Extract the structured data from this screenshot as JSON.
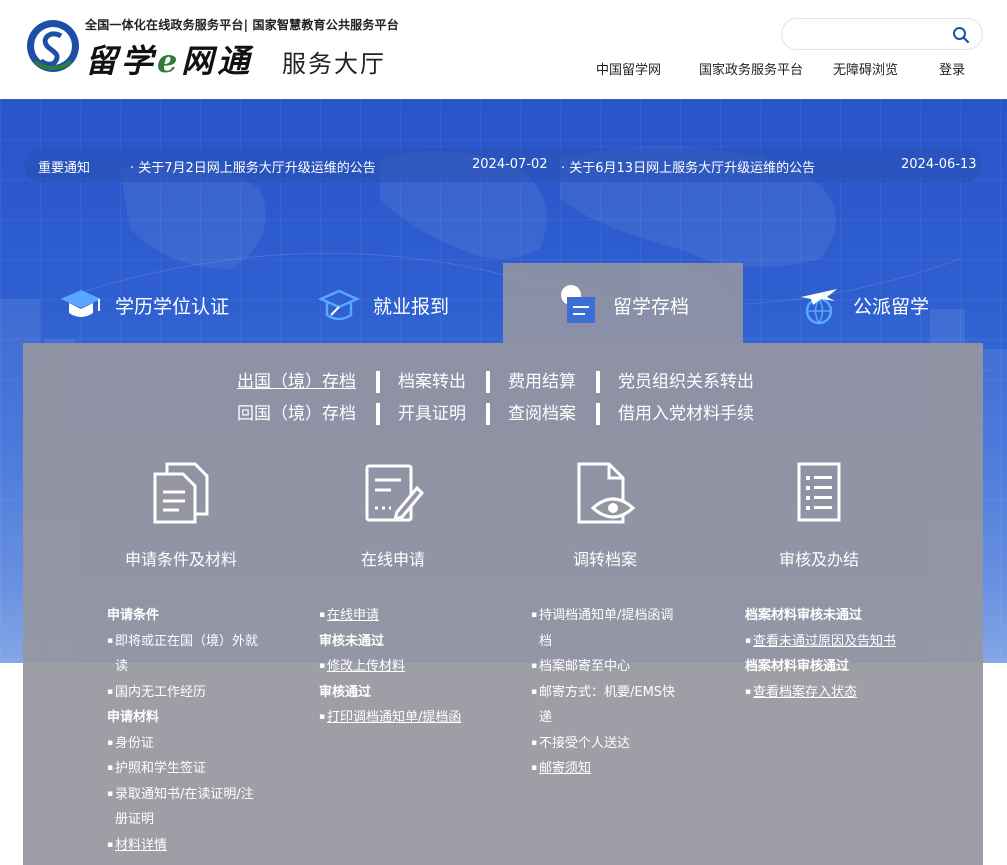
{
  "header": {
    "tagline": "全国一体化在线政务服务平台| 国家智慧教育公共服务平台",
    "title_part1": "留学",
    "title_e": "e",
    "title_part2": "网通",
    "subtitle": "服务大厅",
    "search": {
      "placeholder": "",
      "value": ""
    },
    "nav": [
      "中国留学网",
      "国家政务服务平台",
      "无障碍浏览",
      "登录"
    ]
  },
  "notices": {
    "label": "重要通知",
    "items": [
      {
        "text": "关于7月2日网上服务大厅升级运维的公告",
        "date": "2024-07-02"
      },
      {
        "text": "关于6月13日网上服务大厅升级运维的公告",
        "date": "2024-06-13"
      }
    ]
  },
  "tabs": [
    {
      "label": "学历学位认证",
      "icon": "graduation-cap-icon"
    },
    {
      "label": "就业报到",
      "icon": "scholar-cap-icon"
    },
    {
      "label": "留学存档",
      "icon": "archive-icon",
      "active": true
    },
    {
      "label": "公派留学",
      "icon": "plane-globe-icon"
    }
  ],
  "services": {
    "row1": [
      "出国（境）存档",
      "档案转出",
      "费用结算",
      "党员组织关系转出"
    ],
    "row2": [
      "回国（境）存档",
      "开具证明",
      "查阅档案",
      "借用入党材料手续"
    ]
  },
  "steps": [
    {
      "label": "申请条件及材料",
      "icon": "documents-icon"
    },
    {
      "label": "在线申请",
      "icon": "form-edit-icon"
    },
    {
      "label": "调转档案",
      "icon": "file-view-icon"
    },
    {
      "label": "审核及办结",
      "icon": "checklist-icon"
    }
  ],
  "details": {
    "col1": {
      "h1": "申请条件",
      "c1": "即将或正在国（境）外就",
      "c1b": "读",
      "c2": "国内无工作经历",
      "h2": "申请材料",
      "m1": "身份证",
      "m2": "护照和学生签证",
      "m3": "录取通知书/在读证明/注",
      "m3b": "册证明",
      "m4": "材料详情"
    },
    "col2": {
      "l1": "在线申请",
      "h1": "审核未通过",
      "l2": "修改上传材料",
      "h2": "审核通过",
      "l3": "打印调档通知单/提档函"
    },
    "col3": {
      "i1": "持调档通知单/提档函调",
      "i1b": "档",
      "i2": "档案邮寄至中心",
      "i3": "邮寄方式：机要/EMS快",
      "i3b": "递",
      "i4": "不接受个人送达",
      "i5": "邮寄须知"
    },
    "col4": {
      "h1": "档案材料审核未通过",
      "l1": "查看未通过原因及告知书",
      "h2": "档案材料审核通过",
      "l2": "查看档案存入状态"
    }
  },
  "colors": {
    "banner": "#2e5fd0",
    "panel": "#9696a0",
    "accent": "#1f5fd6"
  }
}
